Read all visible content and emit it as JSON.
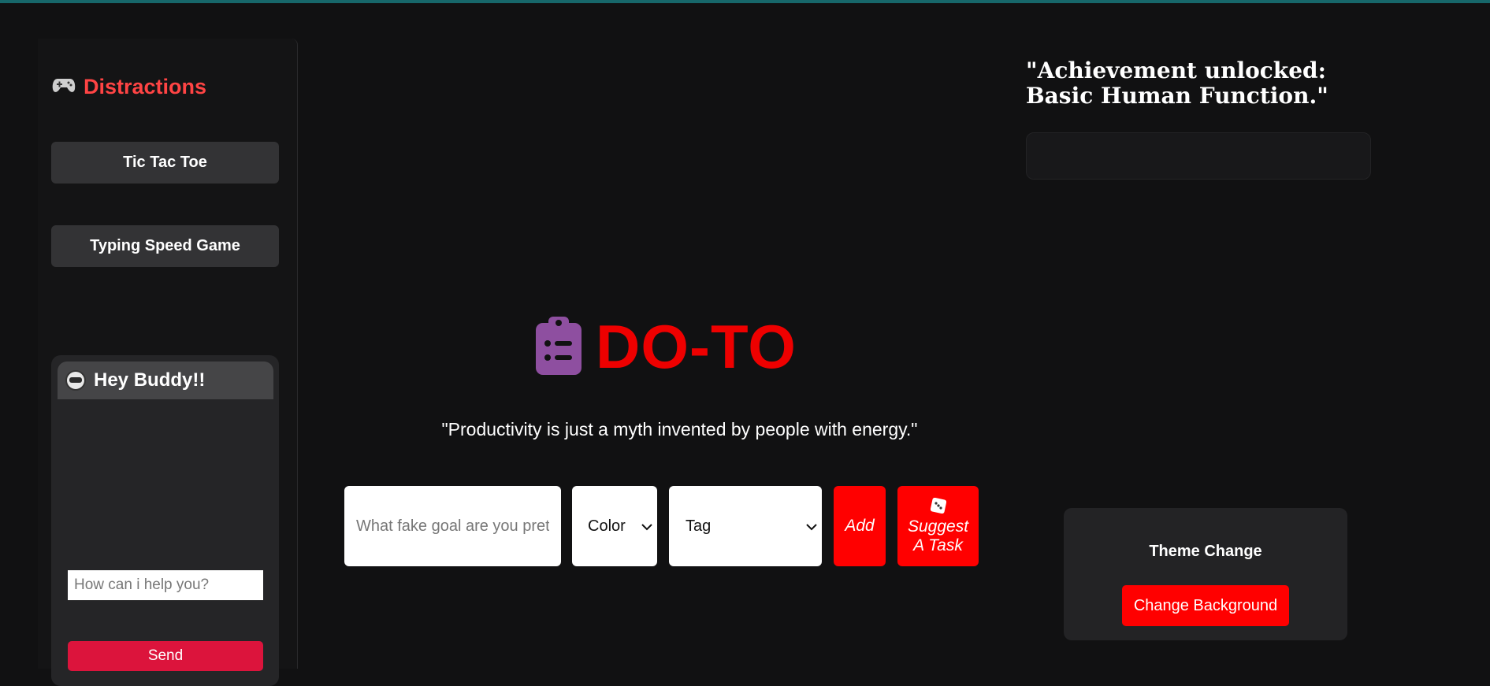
{
  "sidebar": {
    "title": "Distractions",
    "title_icon": "gamepad-icon",
    "games": [
      {
        "label": "Tic Tac Toe"
      },
      {
        "label": "Typing Speed Game"
      }
    ],
    "chat": {
      "header": "Hey Buddy!!",
      "header_icon": "robot-icon",
      "input_placeholder": "How can i help you?",
      "send_label": "Send"
    }
  },
  "main": {
    "brand_icon": "clipboard-list-icon",
    "brand_title": "DO-TO",
    "quote": "\"Productivity is just a myth invented by people with energy.\"",
    "task_input_placeholder": "What fake goal are you pretending to achieve?",
    "color_select": "Color",
    "tag_select": "Tag",
    "add_label": "Add",
    "suggest_icon": "dice-icon",
    "suggest_line1": "Suggest",
    "suggest_line2": "A Task"
  },
  "right": {
    "achievement": "\"Achievement unlocked: Basic Human Function.\"",
    "theme_label": "Theme Change",
    "theme_button": "Change Background"
  },
  "colors": {
    "accent_red": "#ff0000",
    "send_red": "#dc143c",
    "brand_icon_purple": "#8e4fa0",
    "title_red": "#ff4444",
    "top_bar": "#17676a"
  }
}
